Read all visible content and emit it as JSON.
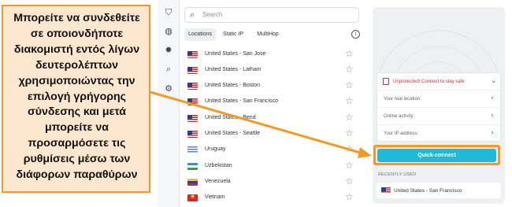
{
  "search": {
    "placeholder": "Search"
  },
  "tabs": [
    "Locations",
    "Static IP",
    "MultiHop"
  ],
  "rail": {
    "icons": [
      "shield-icon",
      "lightbulb-icon",
      "bug-icon",
      "search-icon",
      "gear-icon"
    ]
  },
  "servers": [
    {
      "name": "United States - San Jose",
      "flag": "us"
    },
    {
      "name": "United States - Latham",
      "flag": "us"
    },
    {
      "name": "United States - Boston",
      "flag": "us"
    },
    {
      "name": "United States - San Francisco",
      "flag": "us"
    },
    {
      "name": "United States - Bend",
      "flag": "us"
    },
    {
      "name": "United States - Seattle",
      "flag": "us"
    },
    {
      "name": "Uruguay",
      "flag": "uy"
    },
    {
      "name": "Uzbekistan",
      "flag": "uz"
    },
    {
      "name": "Venezuela",
      "flag": "ve"
    },
    {
      "name": "Vietnam",
      "flag": "vn"
    }
  ],
  "status": {
    "warning": "Unprotected! Connect to stay safe",
    "location_label": "Your real location:",
    "activity_label": "Online activity:",
    "ip_label": "Your IP address:"
  },
  "quick_connect": {
    "label": "Quick-connect"
  },
  "recent": {
    "header": "RECENTLY USED",
    "items": [
      {
        "name": "United States - San Francisco",
        "flag": "us"
      }
    ]
  },
  "annotation": {
    "text": "Μπορείτε να συνδεθείτε σε οποιονδήποτε διακομιστή εντός λίγων δευτερολέπτων χρησιμοποιώντας την επιλογή γρήγορης σύνδεσης και μετά μπορείτε να προσαρμόσετε τις ρυθμίσεις μέσω των διάφορων παραθύρων"
  },
  "colors": {
    "accent": "#20b9d8",
    "callout_border": "#f39a25",
    "callout_bg": "#fde8cf",
    "warning": "#c7303a"
  }
}
